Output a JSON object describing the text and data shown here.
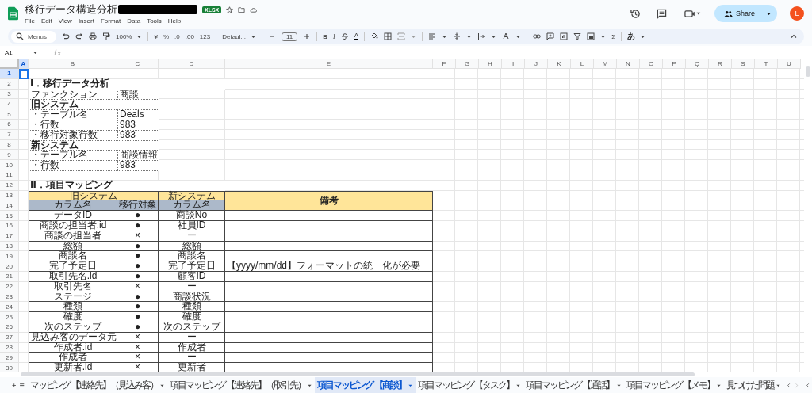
{
  "document": {
    "title": "移行データ構造分析",
    "badge": "XLSX"
  },
  "menu": [
    "File",
    "Edit",
    "View",
    "Insert",
    "Format",
    "Data",
    "Tools",
    "Help"
  ],
  "account": {
    "share": "Share",
    "avatar": "L"
  },
  "toolbar": {
    "search_placeholder": "Menus",
    "zoom": "100%",
    "currency": "¥",
    "percent": "%",
    "decrease_decimals": ".0",
    "increase_decimals": ".00",
    "number_format": "123",
    "font": "Defaul...",
    "font_size": "11",
    "bold": "B",
    "italic": "I",
    "text_color": "A",
    "sum": "Σ",
    "input_tool": "あ"
  },
  "formula_bar": {
    "name_box": "A1"
  },
  "columns": [
    "A",
    "B",
    "C",
    "D",
    "E",
    "F",
    "G",
    "H",
    "I",
    "J",
    "K",
    "L",
    "M",
    "N",
    "O",
    "P",
    "Q",
    "R",
    "S",
    "T",
    "U"
  ],
  "row_numbers": [
    "1",
    "2",
    "3",
    "4",
    "5",
    "6",
    "7",
    "8",
    "9",
    "10",
    "11",
    "12",
    "13",
    "14",
    "15",
    "16",
    "17",
    "18",
    "19",
    "20",
    "21",
    "22",
    "23",
    "24",
    "25",
    "26",
    "27",
    "28",
    "29",
    "30"
  ],
  "sheet": {
    "section_1_title": "Ⅰ．移行データ分析",
    "info_rows": [
      {
        "kind": "pair",
        "label": "ファンクション",
        "value": "商談"
      },
      {
        "kind": "heading",
        "label": "旧システム"
      },
      {
        "kind": "pair",
        "label": "・テーブル名",
        "value": "Deals"
      },
      {
        "kind": "pair",
        "label": "・行数",
        "value": "983"
      },
      {
        "kind": "pair",
        "label": "・移行対象行数",
        "value": "983"
      },
      {
        "kind": "heading",
        "label": "新システム"
      },
      {
        "kind": "pair",
        "label": "・テーブル名",
        "value": "商談情報"
      },
      {
        "kind": "pair",
        "label": "・行数",
        "value": "983"
      }
    ],
    "section_2_title": "Ⅱ．項目マッピング",
    "group_headers": [
      "旧システム",
      "新システム"
    ],
    "notes_header": "備考",
    "sub_headers": [
      "カラム名",
      "移行対象",
      "カラム名"
    ],
    "mapping_rows": [
      {
        "old": "データID",
        "migrate": "●",
        "new": "商談No"
      },
      {
        "old": "商談の担当者.id",
        "migrate": "●",
        "new": "社員ID"
      },
      {
        "old": "商談の担当者",
        "migrate": "×",
        "new": "ー"
      },
      {
        "old": "総額",
        "migrate": "●",
        "new": "総額"
      },
      {
        "old": "商談名",
        "migrate": "●",
        "new": "商談名"
      },
      {
        "old": "完了予定日",
        "migrate": "●",
        "new": "完了予定日",
        "note": "【yyyy/mm/dd】フォーマットの統一化が必要"
      },
      {
        "old": "取引先名.id",
        "migrate": "●",
        "new": "顧客ID"
      },
      {
        "old": "取引先名",
        "migrate": "×",
        "new": "ー"
      },
      {
        "old": "ステージ",
        "migrate": "●",
        "new": "商談状況"
      },
      {
        "old": "種類",
        "migrate": "●",
        "new": "種類"
      },
      {
        "old": "確度",
        "migrate": "●",
        "new": "確度"
      },
      {
        "old": "次のステップ",
        "migrate": "●",
        "new": "次のステップ"
      },
      {
        "old": "見込み客のデータ元",
        "migrate": "×",
        "new": "ー"
      },
      {
        "old": "作成者.id",
        "migrate": "×",
        "new": "作成者"
      },
      {
        "old": "作成者",
        "migrate": "×",
        "new": "ー"
      },
      {
        "old": "更新者.id",
        "migrate": "×",
        "new": "更新者"
      }
    ]
  },
  "sheet_tabs": [
    {
      "label": "マッピング 【連絡先】（見込み客）",
      "selected": false
    },
    {
      "label": "項目マッピング 【連絡先】（取引先）",
      "selected": false
    },
    {
      "label": "項目マッピング 【商談】",
      "selected": true
    },
    {
      "label": "項目マッピング 【タスク】",
      "selected": false
    },
    {
      "label": "項目マッピング 【通話】",
      "selected": false
    },
    {
      "label": "項目マッピング 【メモ】",
      "selected": false
    },
    {
      "label": "見つけた問題",
      "selected": false
    }
  ]
}
